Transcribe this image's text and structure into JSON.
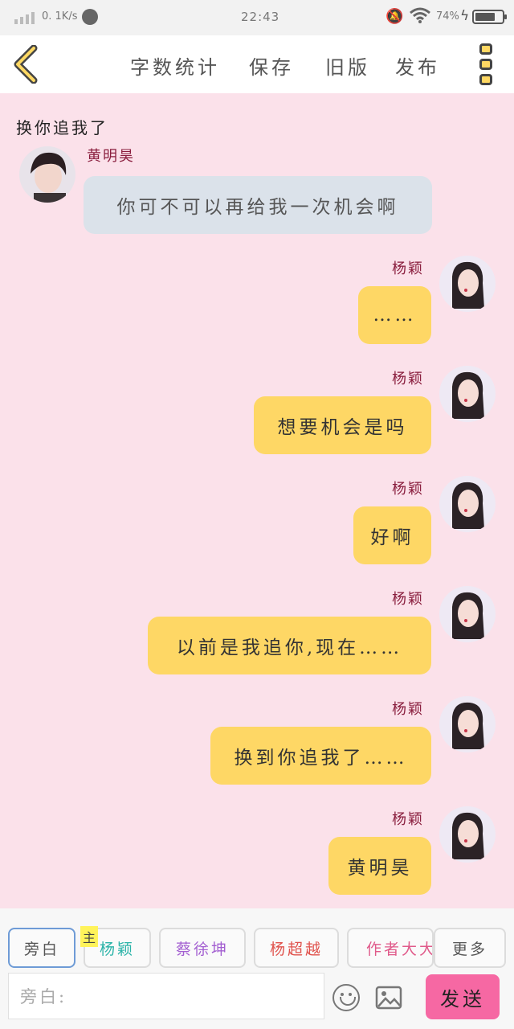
{
  "status_bar": {
    "speed": "0. 1K/s",
    "time": "22:43",
    "battery": "74%",
    "battery_level": 0.74
  },
  "header": {
    "nav": [
      "字数统计",
      "保存",
      "旧版",
      "发布"
    ],
    "accent": "#fed765"
  },
  "scene_title": "换你追我了",
  "messages": [
    {
      "side": "left",
      "speaker": "黄明昊",
      "text": "你可不可以再给我一次机会啊"
    },
    {
      "side": "right",
      "speaker": "杨颖",
      "text": "……"
    },
    {
      "side": "right",
      "speaker": "杨颖",
      "text": "想要机会是吗"
    },
    {
      "side": "right",
      "speaker": "杨颖",
      "text": "好啊"
    },
    {
      "side": "right",
      "speaker": "杨颖",
      "text": "以前是我追你,现在……"
    },
    {
      "side": "right",
      "speaker": "杨颖",
      "text": "换到你追我了……"
    },
    {
      "side": "right",
      "speaker": "杨颖",
      "text": "黄明昊"
    }
  ],
  "characters": [
    {
      "label": "旁白",
      "color": "#555555"
    },
    {
      "label": "杨颖",
      "color": "#2bb3a8"
    },
    {
      "label": "蔡徐坤",
      "color": "#a35fd1"
    },
    {
      "label": "杨超越",
      "color": "#e0524c"
    },
    {
      "label": "作者大大",
      "color": "#e05a8a"
    },
    {
      "label": "更多",
      "color": "#555555"
    }
  ],
  "main_badge": "主",
  "input": {
    "placeholder": "旁白:"
  },
  "send_label": "发送",
  "colors": {
    "background": "#fbe1ea",
    "bubble_right": "#fed765",
    "bubble_left": "#dbe2ea",
    "send": "#f668a3",
    "speaker": "#8a1e3e"
  }
}
